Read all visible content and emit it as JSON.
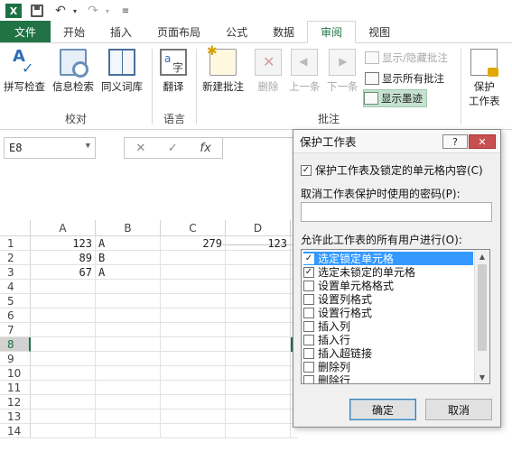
{
  "qat": {
    "logo": "X"
  },
  "tabs": [
    "文件",
    "开始",
    "插入",
    "页面布局",
    "公式",
    "数据",
    "审阅",
    "视图"
  ],
  "ribbon": {
    "proofing": {
      "label": "校对",
      "buttons": [
        "拼写检查",
        "信息检索",
        "同义词库"
      ]
    },
    "language": {
      "label": "语言",
      "buttons": [
        "翻译"
      ]
    },
    "comments": {
      "label": "批注",
      "buttons": [
        "新建批注",
        "删除",
        "上一条",
        "下一条"
      ],
      "small": [
        "显示/隐藏批注",
        "显示所有批注",
        "显示墨迹"
      ]
    },
    "protect": {
      "line1": "保护",
      "line2": "工作表"
    }
  },
  "formula_bar": {
    "name_box": "E8",
    "cancel": "✕",
    "enter": "✓",
    "fx": "fx"
  },
  "grid": {
    "columns": [
      "A",
      "B",
      "C",
      "D"
    ],
    "rows": [
      "1",
      "2",
      "3",
      "4",
      "5",
      "6",
      "7",
      "8",
      "9",
      "10",
      "11",
      "12",
      "13",
      "14"
    ],
    "cells": {
      "A1": "123",
      "B1": "A",
      "C1": "279",
      "D1": "123",
      "A2": "89",
      "B2": "B",
      "A3": "67",
      "B3": "A"
    }
  },
  "dialog": {
    "title": "保护工作表",
    "help": "?",
    "close": "✕",
    "protect_option": "保护工作表及锁定的单元格内容(C)",
    "password_label": "取消工作表保护时使用的密码(P):",
    "allow_label": "允许此工作表的所有用户进行(O):",
    "items": [
      {
        "label": "选定锁定单元格",
        "checked": true,
        "selected": true
      },
      {
        "label": "选定未锁定的单元格",
        "checked": true,
        "selected": false
      },
      {
        "label": "设置单元格格式",
        "checked": false,
        "selected": false
      },
      {
        "label": "设置列格式",
        "checked": false,
        "selected": false
      },
      {
        "label": "设置行格式",
        "checked": false,
        "selected": false
      },
      {
        "label": "插入列",
        "checked": false,
        "selected": false
      },
      {
        "label": "插入行",
        "checked": false,
        "selected": false
      },
      {
        "label": "插入超链接",
        "checked": false,
        "selected": false
      },
      {
        "label": "删除列",
        "checked": false,
        "selected": false
      },
      {
        "label": "删除行",
        "checked": false,
        "selected": false
      }
    ],
    "ok": "确定",
    "cancel": "取消"
  },
  "colors": {
    "excel_green": "#217346",
    "selection_blue": "#3399ff",
    "ink_highlight": "#c5e1cf"
  }
}
